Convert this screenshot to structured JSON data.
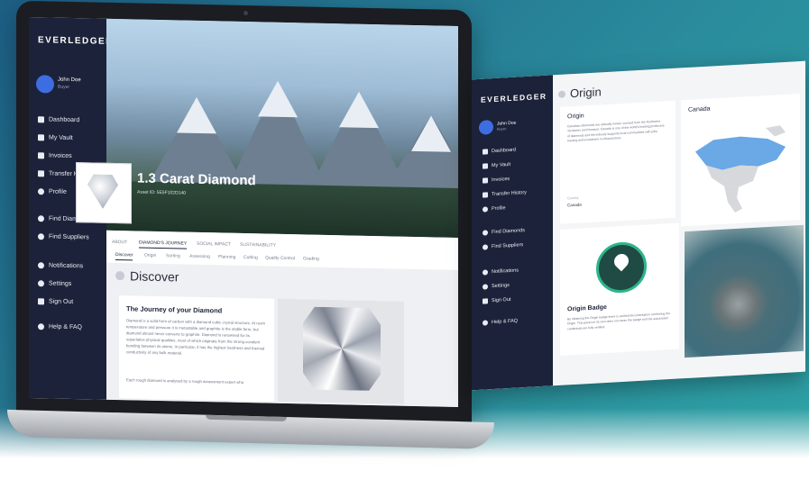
{
  "laptop": {
    "brand_logo": "EVERLEDGER",
    "user": {
      "name": "John Doe",
      "role": "Buyer"
    },
    "nav": [
      {
        "label": "Dashboard",
        "icon": "home-icon"
      },
      {
        "label": "My Vault",
        "icon": "vault-icon"
      },
      {
        "label": "Invoices",
        "icon": "invoice-icon"
      },
      {
        "label": "Transfer History",
        "icon": "transfer-icon"
      },
      {
        "label": "Profile",
        "icon": "user-icon"
      },
      {
        "label": "Find Diamonds",
        "icon": "search-icon"
      },
      {
        "label": "Find Suppliers",
        "icon": "search-icon"
      },
      {
        "label": "Notifications",
        "icon": "bell-icon"
      },
      {
        "label": "Settings",
        "icon": "gear-icon"
      },
      {
        "label": "Sign Out",
        "icon": "signout-icon"
      },
      {
        "label": "Help & FAQ",
        "icon": "help-icon"
      }
    ],
    "diamond_title": "1.3 Carat Diamond",
    "diamond_subtitle": "Asset ID: 5E5F102D140",
    "tabs": [
      "ABOUT",
      "DIAMOND'S JOURNEY",
      "SOCIAL IMPACT",
      "SUSTAINABILITY"
    ],
    "active_tab": "DIAMOND'S JOURNEY",
    "subtabs": [
      "Discover",
      "Origin",
      "Sorting",
      "Assessing",
      "Planning",
      "Cutting",
      "Quality Control",
      "Grading"
    ],
    "section_title": "Discover",
    "card_title": "The Journey of your Diamond",
    "card_text": "Diamond is a solid form of carbon with a diamond cubic crystal structure. At room temperature and pressure it is metastable and graphite is the stable form, but diamond almost never converts to graphite. Diamond is renowned for its superlative physical qualities, most of which originate from the strong covalent bonding between its atoms. In particular, it has the highest hardness and thermal conductivity of any bulk material.",
    "card_text_2": "Each rough diamond is analysed by a rough assessment expert who"
  },
  "screen2": {
    "brand_logo": "EVERLEDGER",
    "user": {
      "name": "John Doe",
      "role": "Buyer"
    },
    "nav": [
      {
        "label": "Dashboard",
        "icon": "home-icon"
      },
      {
        "label": "My Vault",
        "icon": "vault-icon"
      },
      {
        "label": "Invoices",
        "icon": "invoice-icon"
      },
      {
        "label": "Transfer History",
        "icon": "transfer-icon"
      },
      {
        "label": "Profile",
        "icon": "user-icon"
      },
      {
        "label": "Find Diamonds",
        "icon": "search-icon"
      },
      {
        "label": "Find Suppliers",
        "icon": "search-icon"
      },
      {
        "label": "Notifications",
        "icon": "bell-icon"
      },
      {
        "label": "Settings",
        "icon": "gear-icon"
      },
      {
        "label": "Sign Out",
        "icon": "signout-icon"
      },
      {
        "label": "Help & FAQ",
        "icon": "help-icon"
      }
    ],
    "section_title": "Origin",
    "origin_panel_title": "Origin",
    "origin_text": "Canadian diamonds are ethically mined, sourced from the Northwest Territories and Nunavut. Canada is one of the world's leading producers of diamonds and the industry supports local communities with jobs, training and investment in infrastructure.",
    "origin_country_label": "Country",
    "origin_country": "Canada",
    "map_title": "Canada",
    "badge_title": "Origin Badge",
    "badge_text": "By obtaining the Origin badge there is verified documentation confirming the Origin. This panel on its own does not mean the badge and the associated credentials are fully verified.",
    "colors": {
      "sidebar": "#1c2239",
      "accent": "#3d6de0",
      "badge_green": "#2db58a"
    }
  }
}
